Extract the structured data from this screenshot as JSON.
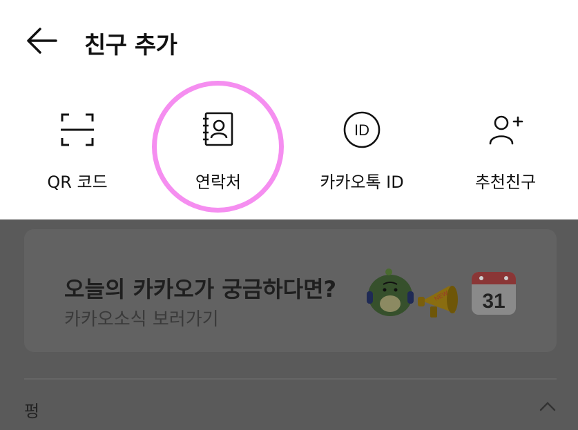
{
  "header": {
    "title": "친구 추가"
  },
  "options": [
    {
      "label": "QR 코드",
      "icon": "qr-scan-icon"
    },
    {
      "label": "연락처",
      "icon": "contacts-book-icon"
    },
    {
      "label": "카카오톡 ID",
      "icon": "id-icon"
    },
    {
      "label": "추천친구",
      "icon": "add-person-icon"
    }
  ],
  "banner": {
    "title": "오늘의 카카오가 궁금하다면?",
    "subtitle": "카카오소식 보러가기",
    "calendar_day": "31",
    "megaphone_text": "NEW"
  },
  "section": {
    "label": "펑"
  },
  "colors": {
    "highlight": "#f58ef0",
    "dim": "#5a5a5a"
  }
}
